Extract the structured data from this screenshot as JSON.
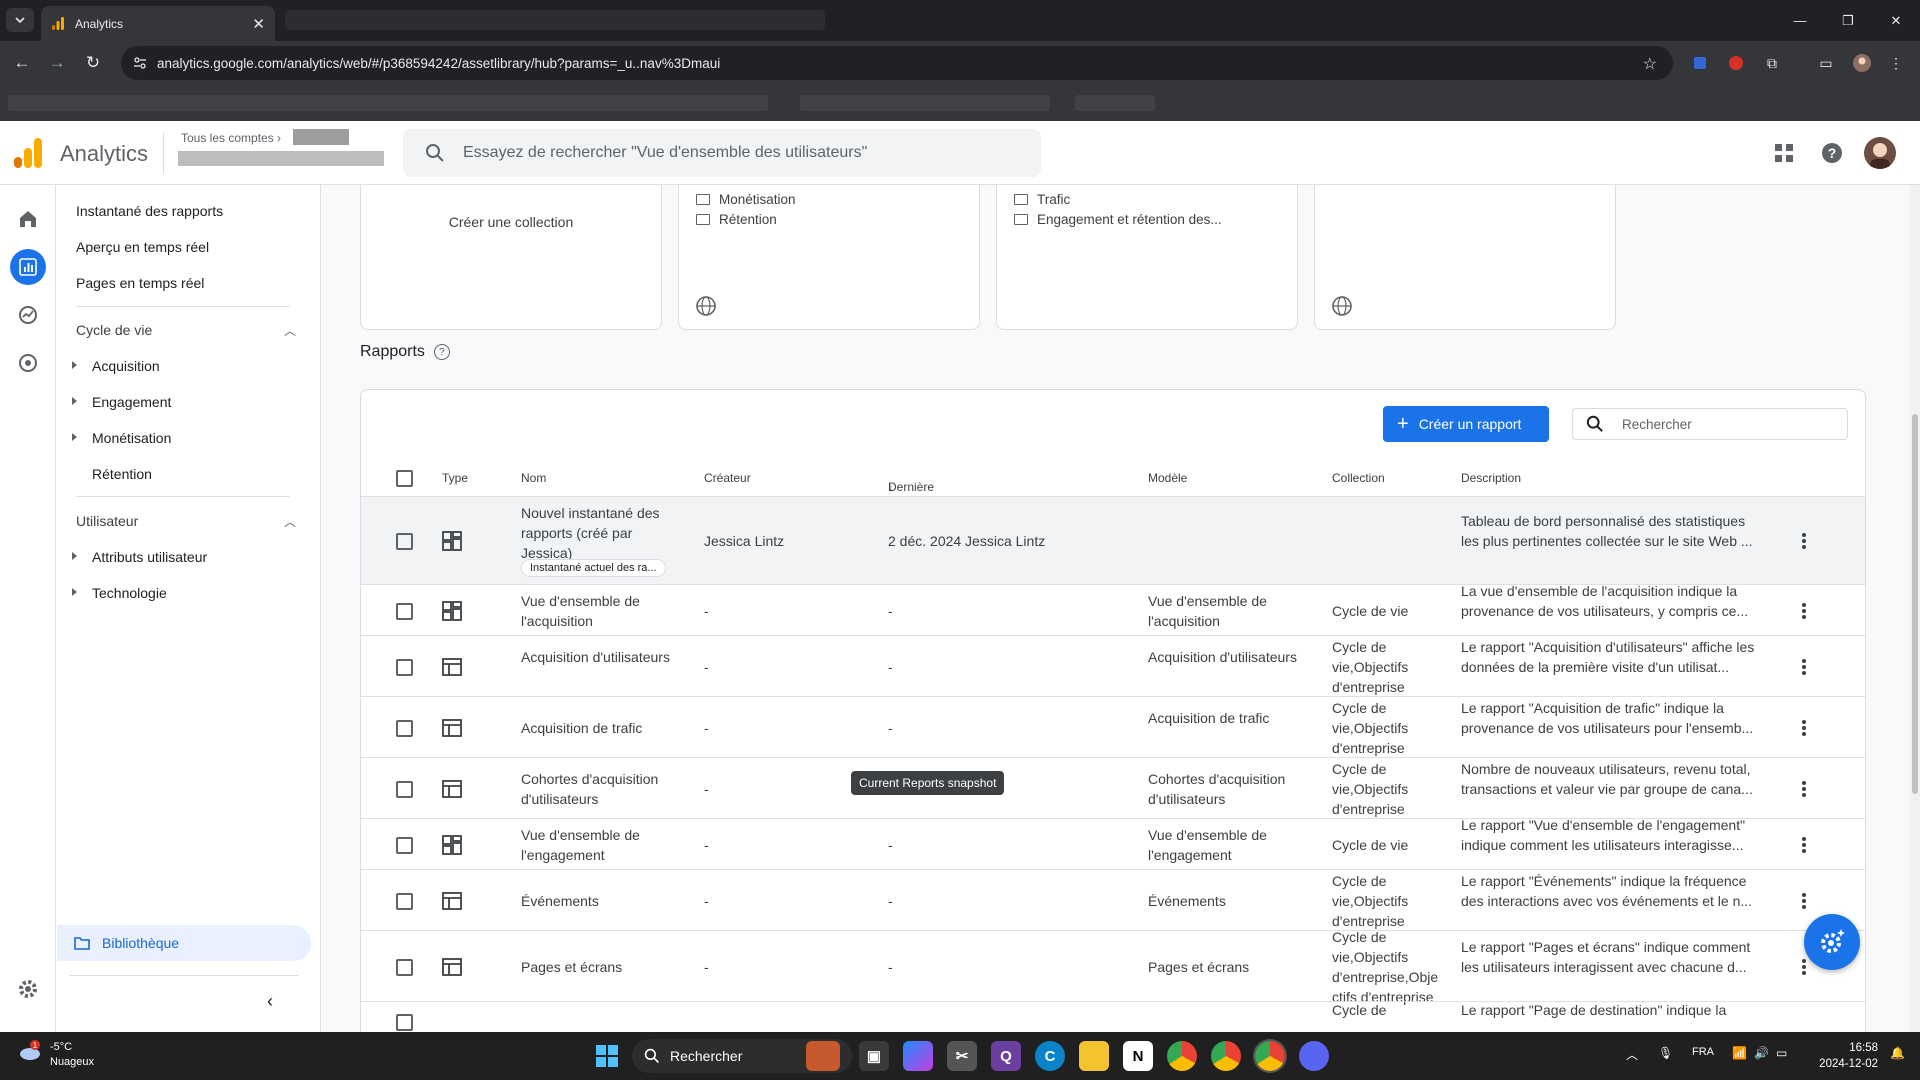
{
  "browser": {
    "tab_title": "Analytics",
    "url": "analytics.google.com/analytics/web/#/p368594242/assetlibrary/hub?params=_u..nav%3Dmaui"
  },
  "header": {
    "app_name": "Analytics",
    "account_label": "Tous les comptes",
    "search_placeholder": "Essayez de rechercher \"Vue d'ensemble des utilisateurs\""
  },
  "sidebar": {
    "top_items": [
      "Instantané des rapports",
      "Aperçu en temps réel",
      "Pages en temps réel"
    ],
    "sections": [
      {
        "title": "Cycle de vie",
        "items": [
          "Acquisition",
          "Engagement",
          "Monétisation",
          "Rétention"
        ]
      },
      {
        "title": "Utilisateur",
        "items": [
          "Attributs utilisateur",
          "Technologie"
        ]
      }
    ],
    "library": "Bibliothèque"
  },
  "collections": {
    "create_label": "Créer une collection",
    "card2_folders": [
      "Monétisation",
      "Rétention"
    ],
    "card3_folders": [
      "Trafic",
      "Engagement et rétention des..."
    ]
  },
  "reports": {
    "title": "Rapports",
    "create_button": "Créer un rapport",
    "search_placeholder": "Rechercher",
    "columns": [
      "Type",
      "Nom",
      "Créateur",
      "Dernière modification",
      "Modèle",
      "Collection",
      "Description"
    ],
    "chip": "Instantané actuel des ra...",
    "tooltip": "Current Reports snapshot",
    "rows": [
      {
        "type": "dashboard",
        "name": "Nouvel instantané des rapports (créé par Jessica)",
        "creator": "Jessica Lintz",
        "modified": "2 déc. 2024 Jessica Lintz",
        "model": "",
        "collection": "",
        "description": "Tableau de bord personnalisé des statistiques les plus pertinentes collectée sur le site Web ..."
      },
      {
        "type": "dashboard",
        "name": "Vue d'ensemble de l'acquisition",
        "creator": "-",
        "modified": "-",
        "model": "Vue d'ensemble de l'acquisition",
        "collection": "Cycle de vie",
        "description": "La vue d'ensemble de l'acquisition indique la provenance de vos utilisateurs, y compris ce..."
      },
      {
        "type": "table",
        "name": "Acquisition d'utilisateurs",
        "creator": "-",
        "modified": "-",
        "model": "Acquisition d'utilisateurs",
        "collection": "Cycle de vie,Objectifs d'entreprise",
        "description": "Le rapport \"Acquisition d'utilisateurs\" affiche les données de la première visite d'un utilisat..."
      },
      {
        "type": "table",
        "name": "Acquisition de trafic",
        "creator": "-",
        "modified": "-",
        "model": "Acquisition de trafic",
        "collection": "Cycle de vie,Objectifs d'entreprise",
        "description": "Le rapport \"Acquisition de trafic\" indique la provenance de vos utilisateurs pour l'ensemb..."
      },
      {
        "type": "table",
        "name": "Cohortes d'acquisition d'utilisateurs",
        "creator": "-",
        "modified": "-",
        "model": "Cohortes d'acquisition d'utilisateurs",
        "collection": "Cycle de vie,Objectifs d'entreprise",
        "description": "Nombre de nouveaux utilisateurs, revenu total, transactions et valeur vie par groupe de cana..."
      },
      {
        "type": "dashboard",
        "name": "Vue d'ensemble de l'engagement",
        "creator": "-",
        "modified": "-",
        "model": "Vue d'ensemble de l'engagement",
        "collection": "Cycle de vie",
        "description": "Le rapport \"Vue d'ensemble de l'engagement\" indique comment les utilisateurs interagisse..."
      },
      {
        "type": "table",
        "name": "Événements",
        "creator": "-",
        "modified": "-",
        "model": "Événements",
        "collection": "Cycle de vie,Objectifs d'entreprise",
        "description": "Le rapport \"Événements\" indique la fréquence des interactions avec vos événements et le n..."
      },
      {
        "type": "table",
        "name": "Pages et écrans",
        "creator": "-",
        "modified": "-",
        "model": "Pages et écrans",
        "collection": "Cycle de vie,Objectifs d'entreprise,Objectifs d'entreprise",
        "description": "Le rapport \"Pages et écrans\" indique comment les utilisateurs interagissent avec chacune d..."
      },
      {
        "type": "table",
        "name": "",
        "creator": "",
        "modified": "",
        "model": "",
        "collection": "Cycle de",
        "description": "Le rapport \"Page de destination\" indique la"
      }
    ]
  },
  "taskbar": {
    "temp": "-5°C",
    "weather": "Nuageux",
    "search": "Rechercher",
    "lang": "FRA",
    "time": "16:58",
    "date": "2024-12-02"
  }
}
